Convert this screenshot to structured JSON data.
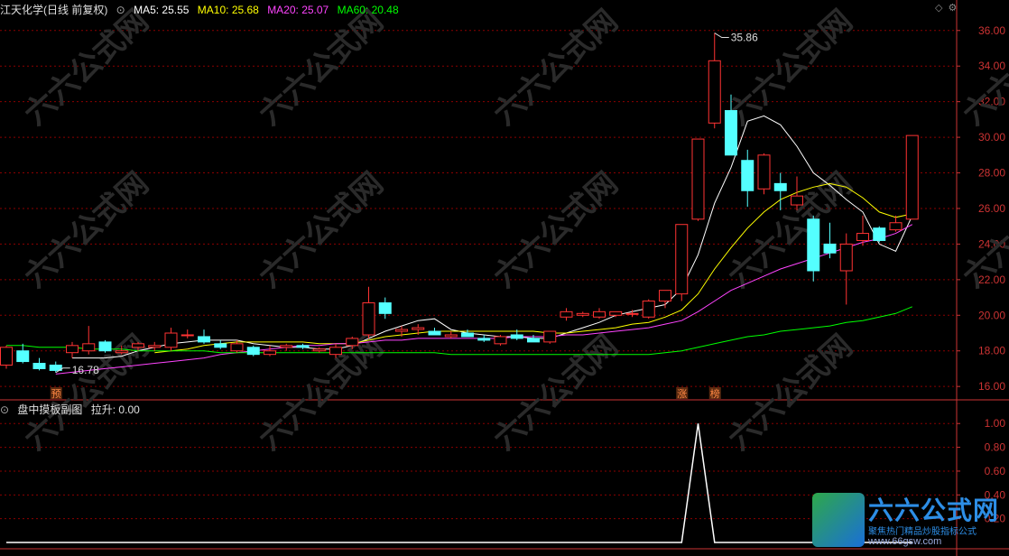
{
  "header": {
    "title": "江天化学(日线 前复权)",
    "ma": [
      {
        "label": "MA5: 25.55",
        "color": "#ffffff"
      },
      {
        "label": "MA10: 25.68",
        "color": "#ffff00"
      },
      {
        "label": "MA20: 25.07",
        "color": "#ff44ff"
      },
      {
        "label": "MA60: 20.48",
        "color": "#00ff00"
      }
    ]
  },
  "sub_header": {
    "title": "盘中摸板副图",
    "value_label": "拉升: 0.00"
  },
  "markers": {
    "forecast": "预",
    "limit_up": "涨",
    "list": "榜"
  },
  "watermark": {
    "text": "六六公式网",
    "sub": "聚焦热门精品炒股指标公式",
    "url": "www.66gsw.com"
  },
  "colors": {
    "up": "#ff3333",
    "down": "#54ffff",
    "grid": "#8b0000",
    "axis_text": "#cc3333",
    "signal": "#ffffff"
  },
  "chart_data": [
    {
      "type": "candlestick",
      "title": "江天化学(日线 前复权)",
      "ylim": [
        15.4,
        36.8
      ],
      "yticks": [
        16.0,
        18.0,
        20.0,
        22.0,
        24.0,
        26.0,
        28.0,
        30.0,
        32.0,
        34.0,
        36.0
      ],
      "annotations": [
        {
          "label": "35.86",
          "at": "high"
        },
        {
          "label": "16.78",
          "at": "low"
        }
      ],
      "ohlc": [
        [
          17.2,
          18.3,
          17.0,
          18.2
        ],
        [
          18.0,
          18.4,
          17.3,
          17.4
        ],
        [
          17.3,
          17.6,
          16.9,
          17.0
        ],
        [
          17.2,
          17.4,
          16.78,
          16.9
        ],
        [
          17.9,
          18.5,
          17.6,
          18.3
        ],
        [
          18.0,
          19.4,
          17.8,
          18.4
        ],
        [
          18.5,
          18.6,
          17.9,
          18.0
        ],
        [
          17.9,
          18.3,
          17.8,
          18.0
        ],
        [
          18.2,
          18.5,
          18.0,
          18.4
        ],
        [
          18.2,
          18.5,
          18.0,
          18.3
        ],
        [
          18.2,
          19.3,
          18.0,
          19.0
        ],
        [
          18.9,
          19.2,
          18.7,
          18.9
        ],
        [
          18.8,
          19.2,
          18.4,
          18.5
        ],
        [
          18.4,
          18.6,
          18.1,
          18.2
        ],
        [
          18.0,
          18.6,
          17.9,
          18.4
        ],
        [
          18.2,
          18.3,
          17.7,
          17.8
        ],
        [
          17.8,
          18.3,
          17.7,
          18.0
        ],
        [
          18.2,
          18.4,
          18.0,
          18.3
        ],
        [
          18.3,
          18.4,
          18.1,
          18.2
        ],
        [
          18.0,
          18.2,
          17.9,
          18.1
        ],
        [
          17.8,
          18.4,
          17.6,
          18.2
        ],
        [
          18.3,
          18.8,
          18.1,
          18.7
        ],
        [
          18.9,
          21.6,
          18.7,
          20.7
        ],
        [
          20.7,
          21.0,
          19.8,
          20.1
        ],
        [
          19.1,
          19.4,
          18.8,
          19.2
        ],
        [
          19.2,
          19.5,
          18.9,
          19.3
        ],
        [
          19.1,
          19.3,
          18.9,
          18.9
        ],
        [
          18.8,
          19.1,
          18.7,
          18.9
        ],
        [
          19.0,
          19.2,
          18.8,
          18.8
        ],
        [
          18.7,
          18.9,
          18.5,
          18.6
        ],
        [
          18.4,
          18.9,
          18.3,
          18.8
        ],
        [
          18.9,
          19.2,
          18.6,
          18.7
        ],
        [
          18.7,
          18.9,
          18.5,
          18.5
        ],
        [
          18.5,
          19.1,
          18.4,
          19.1
        ],
        [
          19.9,
          20.4,
          19.7,
          20.2
        ],
        [
          20.0,
          20.2,
          19.9,
          20.1
        ],
        [
          19.9,
          20.4,
          19.8,
          20.2
        ],
        [
          20.0,
          20.2,
          19.9,
          20.2
        ],
        [
          20.1,
          20.3,
          19.9,
          20.1
        ],
        [
          19.9,
          20.9,
          19.8,
          20.8
        ],
        [
          20.8,
          21.4,
          20.4,
          21.4
        ],
        [
          21.2,
          25.1,
          20.8,
          25.1
        ],
        [
          25.4,
          29.9,
          25.3,
          29.9
        ],
        [
          30.8,
          35.86,
          30.5,
          34.3
        ],
        [
          31.5,
          32.4,
          29.0,
          29.0
        ],
        [
          28.7,
          29.3,
          26.1,
          27.0
        ],
        [
          27.1,
          29.1,
          26.8,
          29.0
        ],
        [
          27.4,
          28.0,
          25.9,
          27.0
        ],
        [
          26.2,
          27.8,
          25.9,
          26.7
        ],
        [
          25.4,
          25.6,
          21.9,
          22.5
        ],
        [
          24.0,
          25.2,
          23.2,
          23.5
        ],
        [
          22.5,
          24.6,
          20.6,
          24.0
        ],
        [
          24.2,
          25.6,
          23.9,
          24.6
        ],
        [
          24.9,
          25.0,
          24.1,
          24.2
        ],
        [
          24.8,
          25.6,
          24.7,
          25.2
        ],
        [
          25.4,
          30.1,
          25.4,
          30.1
        ]
      ],
      "series": [
        {
          "name": "MA5",
          "color": "#ffffff",
          "values": [
            null,
            null,
            null,
            null,
            17.6,
            17.6,
            17.6,
            17.7,
            18.0,
            18.2,
            18.4,
            18.5,
            18.6,
            18.6,
            18.6,
            18.4,
            18.3,
            18.2,
            18.2,
            18.1,
            18.1,
            18.3,
            18.7,
            19.1,
            19.4,
            19.7,
            19.8,
            19.2,
            19.0,
            18.9,
            18.8,
            18.8,
            18.7,
            18.7,
            19.0,
            19.3,
            19.6,
            20.0,
            20.2,
            20.4,
            20.6,
            21.5,
            23.4,
            26.3,
            28.3,
            30.9,
            31.2,
            30.7,
            29.5,
            28.0,
            27.3,
            26.5,
            25.8,
            24.0,
            23.6,
            25.6
          ]
        },
        {
          "name": "MA10",
          "color": "#ffff00",
          "values": [
            null,
            null,
            null,
            null,
            null,
            null,
            null,
            null,
            null,
            17.9,
            18.0,
            18.1,
            18.3,
            18.4,
            18.5,
            18.5,
            18.5,
            18.5,
            18.5,
            18.4,
            18.4,
            18.4,
            18.6,
            18.8,
            18.9,
            19.0,
            19.1,
            19.1,
            19.1,
            19.1,
            19.1,
            19.1,
            19.1,
            19.0,
            19.0,
            19.1,
            19.2,
            19.3,
            19.5,
            19.6,
            19.9,
            20.3,
            21.2,
            22.6,
            23.8,
            24.9,
            25.8,
            26.5,
            26.9,
            27.2,
            27.4,
            27.2,
            26.6,
            25.8,
            25.5,
            25.7
          ]
        },
        {
          "name": "MA20",
          "color": "#ff44ff",
          "values": [
            null,
            null,
            null,
            16.7,
            16.8,
            16.9,
            17.0,
            17.1,
            17.2,
            17.3,
            17.4,
            17.5,
            17.6,
            17.8,
            17.9,
            18.0,
            18.1,
            18.2,
            18.3,
            18.3,
            18.4,
            18.4,
            18.5,
            18.6,
            18.6,
            18.7,
            18.7,
            18.7,
            18.7,
            18.7,
            18.7,
            18.8,
            18.8,
            18.8,
            18.9,
            18.9,
            19.0,
            19.1,
            19.2,
            19.3,
            19.5,
            19.7,
            20.2,
            20.8,
            21.4,
            21.8,
            22.2,
            22.6,
            22.9,
            23.2,
            23.5,
            23.8,
            24.1,
            24.3,
            24.6,
            25.1
          ]
        },
        {
          "name": "MA60",
          "color": "#00ff00",
          "values": [
            18.3,
            18.3,
            18.2,
            18.2,
            18.2,
            18.1,
            18.1,
            18.1,
            18.0,
            18.0,
            18.0,
            18.0,
            18.0,
            17.9,
            17.9,
            17.9,
            17.9,
            17.9,
            17.9,
            17.9,
            17.9,
            17.9,
            17.9,
            17.9,
            17.9,
            17.9,
            17.9,
            17.8,
            17.8,
            17.8,
            17.8,
            17.8,
            17.8,
            17.8,
            17.8,
            17.8,
            17.8,
            17.8,
            17.8,
            17.8,
            17.9,
            18.0,
            18.2,
            18.4,
            18.6,
            18.8,
            18.9,
            19.1,
            19.2,
            19.3,
            19.4,
            19.6,
            19.7,
            19.9,
            20.1,
            20.48
          ]
        }
      ]
    },
    {
      "type": "line",
      "title": "盘中摸板副图",
      "ylim": [
        -0.03,
        1.07
      ],
      "yticks": [
        0.2,
        0.4,
        0.6,
        0.8,
        1.0
      ],
      "series": [
        {
          "name": "拉升",
          "color": "#ffffff",
          "values": [
            0,
            0,
            0,
            0,
            0,
            0,
            0,
            0,
            0,
            0,
            0,
            0,
            0,
            0,
            0,
            0,
            0,
            0,
            0,
            0,
            0,
            0,
            0,
            0,
            0,
            0,
            0,
            0,
            0,
            0,
            0,
            0,
            0,
            0,
            0,
            0,
            0,
            0,
            0,
            0,
            0,
            0,
            1,
            0,
            0,
            0,
            0,
            0,
            0,
            0,
            0,
            0,
            0,
            0,
            0,
            0
          ]
        }
      ]
    }
  ]
}
